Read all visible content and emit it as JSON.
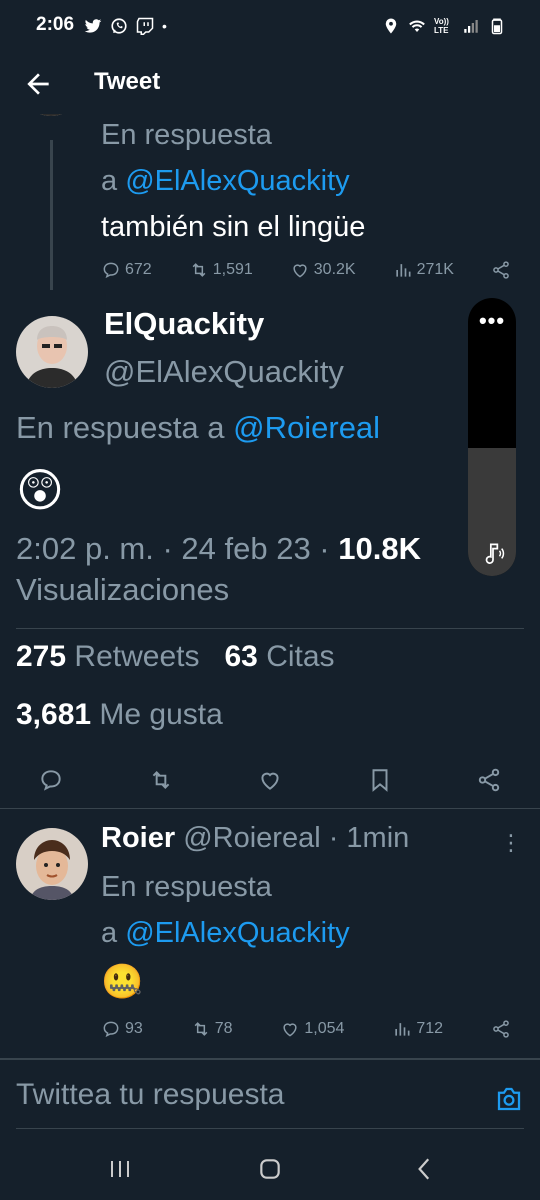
{
  "status": {
    "time": "2:06",
    "left_icons": [
      "twitter-icon",
      "whatsapp-icon",
      "twitch-icon",
      "dot"
    ],
    "right_icons": [
      "location-icon",
      "wifi-icon",
      "volte-icon",
      "signal-icon",
      "battery-icon"
    ],
    "volte_label": "Vo)) LTE"
  },
  "header": {
    "title": "Tweet"
  },
  "reply1": {
    "reply_prefix": "En respuesta",
    "reply_a": "a ",
    "reply_handle": "@ElAlexQuackity",
    "text": "también sin el lingüe",
    "stats": {
      "replies": "672",
      "retweets": "1,591",
      "likes": "30.2K",
      "views": "271K"
    }
  },
  "main": {
    "name": "ElQuackity",
    "handle": "@ElAlexQuackity",
    "reply_prefix": "En respuesta a ",
    "reply_handle": "@Roiereal",
    "emoji": "😲",
    "time": "2:02 p. m. · 24 feb 23 · ",
    "views_count": "10.8K",
    "views_label": "Visualizaciones",
    "retweets_count": "275",
    "retweets_label": "Retweets",
    "quotes_count": "63",
    "quotes_label": "Citas",
    "likes_count": "3,681",
    "likes_label": "Me gusta"
  },
  "volume": {
    "level_percent": 46,
    "dots": "•••"
  },
  "reply2": {
    "name": "Roier",
    "handle": "@Roiereal",
    "time": " · 1min",
    "reply_prefix": "En respuesta",
    "reply_a": "a ",
    "reply_handle": "@ElAlexQuackity",
    "emoji": "🤐",
    "stats": {
      "replies": "93",
      "retweets": "78",
      "likes": "1,054",
      "views": "712"
    }
  },
  "composer": {
    "placeholder": "Twittea tu respuesta"
  },
  "colors": {
    "background": "#15202b",
    "muted": "#8899a6",
    "accent": "#1d9bf0",
    "divider": "#38444d"
  }
}
